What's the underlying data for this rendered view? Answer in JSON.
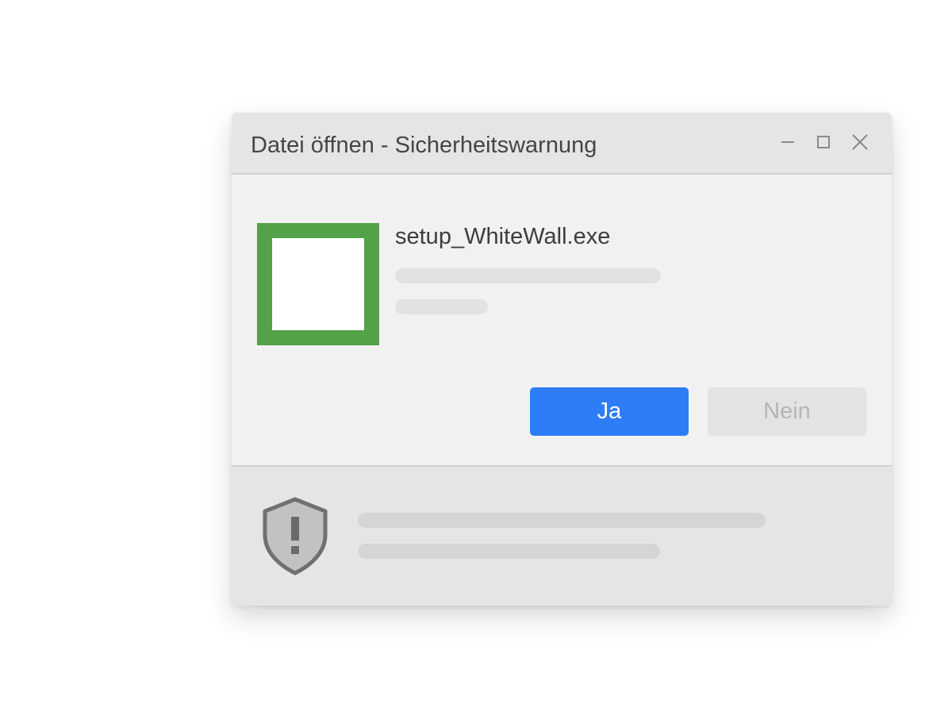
{
  "dialog": {
    "title": "Datei öffnen - Sicherheitswarnung",
    "window_controls": [
      "minimize-icon",
      "maximize-icon",
      "close-icon"
    ]
  },
  "file": {
    "name": "setup_WhiteWall.exe",
    "icon": "file-icon",
    "icon_color": "#53a249"
  },
  "buttons": {
    "yes_label": "Ja",
    "no_label": "Nein"
  },
  "footer": {
    "icon": "shield-warning-icon"
  },
  "colors": {
    "accent": "#2e7cf6",
    "file_icon": "#53a249",
    "disabled_text": "#b6b6b8"
  }
}
